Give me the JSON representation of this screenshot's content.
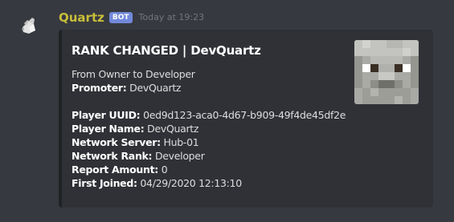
{
  "message": {
    "username": "Quartz",
    "bot_tag": "BOT",
    "timestamp": "Today at 19:23",
    "avatar_icon": "quartz-crystal-avatar-icon"
  },
  "embed": {
    "title": "RANK CHANGED | DevQuartz",
    "description_line": "From Owner to Developer",
    "thumbnail_icon": "player-skin-face-icon",
    "fields": [
      {
        "key": "Promoter:",
        "value": "DevQuartz"
      },
      {
        "key": "Player UUID:",
        "value": "0ed9d123-aca0-4d67-b909-49f4de45df2e"
      },
      {
        "key": "Player Name:",
        "value": "DevQuartz"
      },
      {
        "key": "Network Server:",
        "value": "Hub-01"
      },
      {
        "key": "Network Rank:",
        "value": "Developer"
      },
      {
        "key": "Report Amount:",
        "value": "0"
      },
      {
        "key": "First Joined:",
        "value": "04/29/2020 12:13:10"
      }
    ]
  },
  "colors": {
    "background": "#36393f",
    "embed_background": "#2f3136",
    "embed_border": "#202225",
    "username": "#c9be3a",
    "bot_tag": "#7289da",
    "timestamp": "#72767d",
    "text": "#dcddde",
    "title": "#ffffff"
  }
}
